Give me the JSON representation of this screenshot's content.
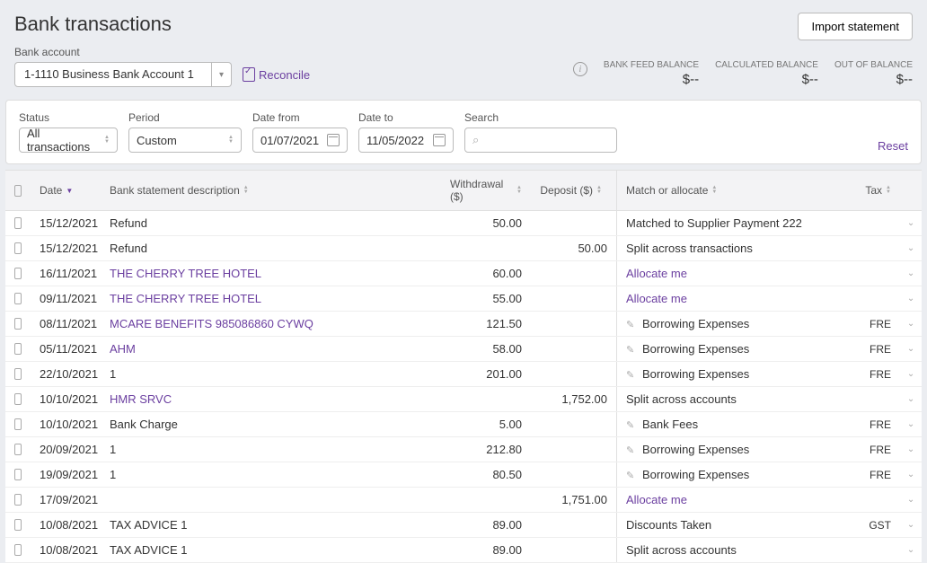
{
  "page": {
    "title": "Bank transactions",
    "import_btn": "Import statement",
    "bank_label": "Bank account",
    "account": "1-1110 Business Bank Account 1",
    "reconcile": "Reconcile"
  },
  "balances": {
    "feed_label": "BANK FEED BALANCE",
    "feed_value": "$--",
    "calc_label": "CALCULATED BALANCE",
    "calc_value": "$--",
    "oob_label": "OUT OF BALANCE",
    "oob_value": "$--"
  },
  "filters": {
    "status_label": "Status",
    "status_value": "All transactions",
    "period_label": "Period",
    "period_value": "Custom",
    "datefrom_label": "Date from",
    "datefrom_value": "01/07/2021",
    "dateto_label": "Date to",
    "dateto_value": "11/05/2022",
    "search_label": "Search",
    "reset": "Reset"
  },
  "headers": {
    "date": "Date",
    "desc": "Bank statement description",
    "withdrawal": "Withdrawal ($)",
    "deposit": "Deposit ($)",
    "match": "Match or allocate",
    "tax": "Tax"
  },
  "rows": [
    {
      "date": "15/12/2021",
      "desc": "Refund",
      "link": false,
      "withdrawal": "50.00",
      "deposit": "",
      "match": "Matched to Supplier Payment 222",
      "match_type": "text",
      "tax": ""
    },
    {
      "date": "15/12/2021",
      "desc": "Refund",
      "link": false,
      "withdrawal": "",
      "deposit": "50.00",
      "match": "Split across transactions",
      "match_type": "text",
      "tax": ""
    },
    {
      "date": "16/11/2021",
      "desc": "THE CHERRY TREE HOTEL",
      "link": true,
      "withdrawal": "60.00",
      "deposit": "",
      "match": "Allocate me",
      "match_type": "allocate",
      "tax": ""
    },
    {
      "date": "09/11/2021",
      "desc": "THE CHERRY TREE HOTEL",
      "link": true,
      "withdrawal": "55.00",
      "deposit": "",
      "match": "Allocate me",
      "match_type": "allocate",
      "tax": ""
    },
    {
      "date": "08/11/2021",
      "desc": "MCARE BENEFITS 985086860 CYWQ",
      "link": true,
      "withdrawal": "121.50",
      "deposit": "",
      "match": "Borrowing Expenses",
      "match_type": "wand",
      "tax": "FRE"
    },
    {
      "date": "05/11/2021",
      "desc": "AHM",
      "link": true,
      "withdrawal": "58.00",
      "deposit": "",
      "match": "Borrowing Expenses",
      "match_type": "wand",
      "tax": "FRE"
    },
    {
      "date": "22/10/2021",
      "desc": "1",
      "link": false,
      "withdrawal": "201.00",
      "deposit": "",
      "match": "Borrowing Expenses",
      "match_type": "wand",
      "tax": "FRE"
    },
    {
      "date": "10/10/2021",
      "desc": "HMR SRVC",
      "link": true,
      "withdrawal": "",
      "deposit": "1,752.00",
      "match": "Split across accounts",
      "match_type": "text",
      "tax": ""
    },
    {
      "date": "10/10/2021",
      "desc": "Bank Charge",
      "link": false,
      "withdrawal": "5.00",
      "deposit": "",
      "match": "Bank Fees",
      "match_type": "wand",
      "tax": "FRE"
    },
    {
      "date": "20/09/2021",
      "desc": "1",
      "link": false,
      "withdrawal": "212.80",
      "deposit": "",
      "match": "Borrowing Expenses",
      "match_type": "wand",
      "tax": "FRE"
    },
    {
      "date": "19/09/2021",
      "desc": "1",
      "link": false,
      "withdrawal": "80.50",
      "deposit": "",
      "match": "Borrowing Expenses",
      "match_type": "wand",
      "tax": "FRE"
    },
    {
      "date": "17/09/2021",
      "desc": "",
      "link": false,
      "withdrawal": "",
      "deposit": "1,751.00",
      "match": "Allocate me",
      "match_type": "allocate",
      "tax": ""
    },
    {
      "date": "10/08/2021",
      "desc": "TAX ADVICE 1",
      "link": false,
      "withdrawal": "89.00",
      "deposit": "",
      "match": "Discounts Taken",
      "match_type": "text",
      "tax": "GST"
    },
    {
      "date": "10/08/2021",
      "desc": "TAX ADVICE 1",
      "link": false,
      "withdrawal": "89.00",
      "deposit": "",
      "match": "Split across accounts",
      "match_type": "text",
      "tax": ""
    }
  ]
}
